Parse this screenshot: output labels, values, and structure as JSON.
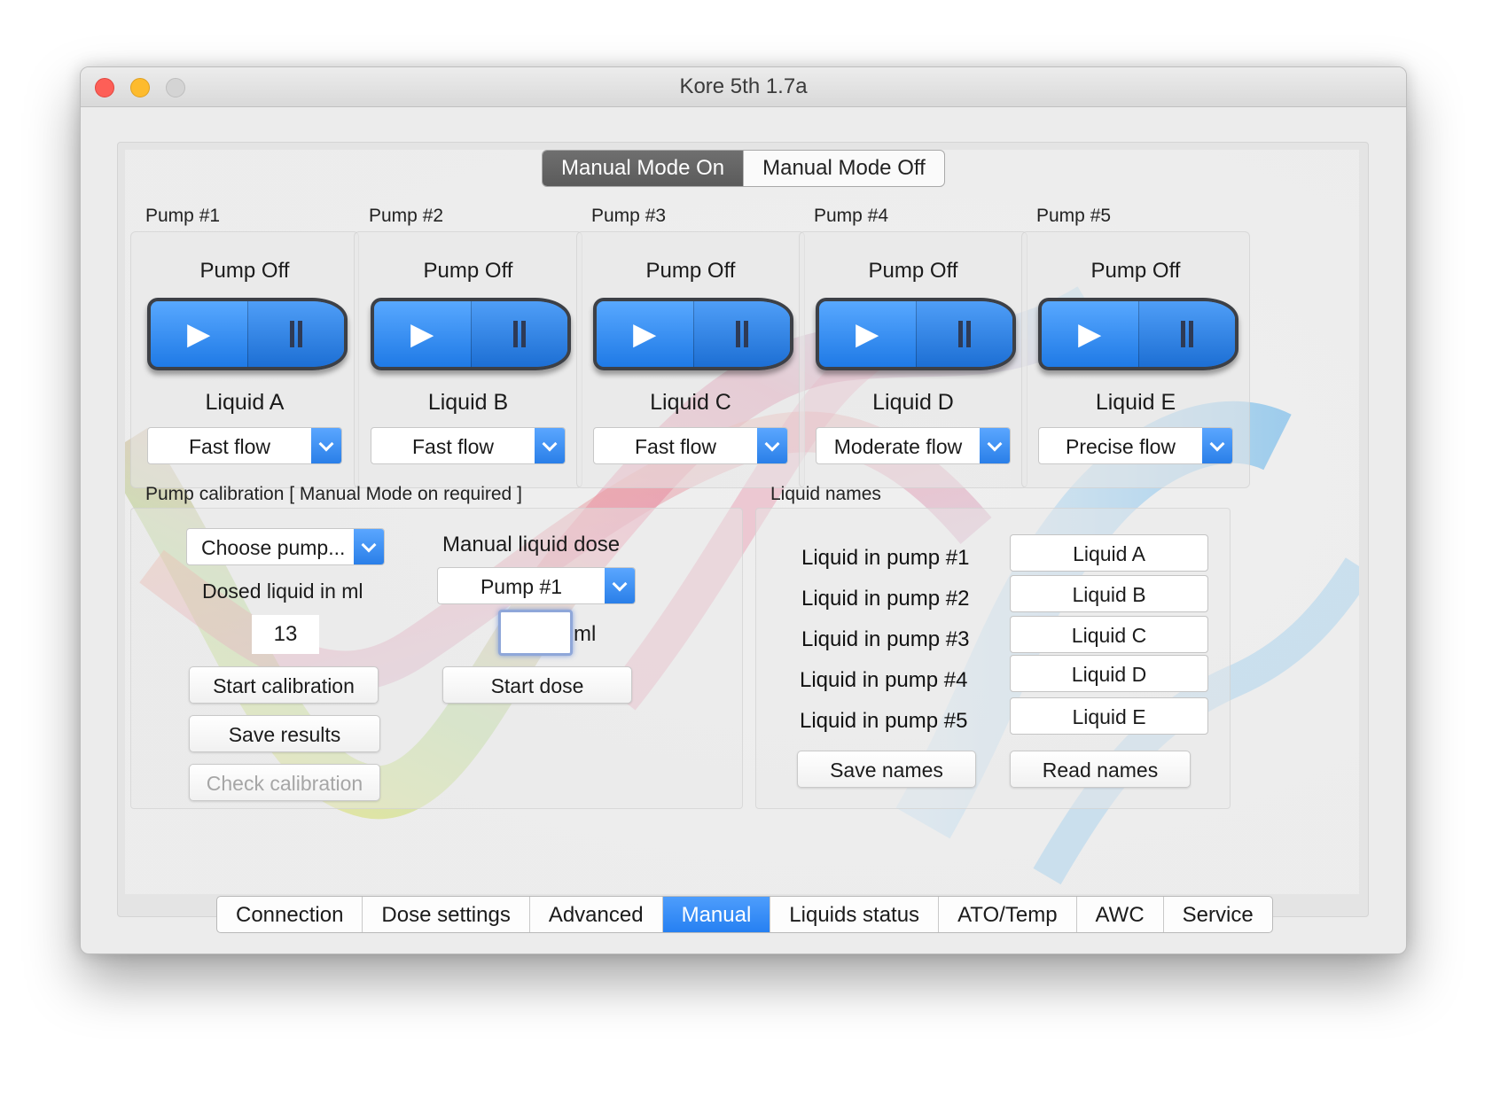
{
  "window": {
    "title": "Kore 5th 1.7a"
  },
  "mode_toggle": {
    "on_label": "Manual Mode On",
    "off_label": "Manual Mode Off",
    "active": "on"
  },
  "pumps": [
    {
      "label": "Pump #1",
      "status": "Pump Off",
      "liquid": "Liquid A",
      "flow": "Fast flow"
    },
    {
      "label": "Pump #2",
      "status": "Pump Off",
      "liquid": "Liquid B",
      "flow": "Fast flow"
    },
    {
      "label": "Pump #3",
      "status": "Pump Off",
      "liquid": "Liquid C",
      "flow": "Fast flow"
    },
    {
      "label": "Pump #4",
      "status": "Pump Off",
      "liquid": "Liquid D",
      "flow": "Moderate flow"
    },
    {
      "label": "Pump #5",
      "status": "Pump Off",
      "liquid": "Liquid E",
      "flow": "Precise flow"
    }
  ],
  "calibration": {
    "section_label": "Pump calibration [ Manual Mode on required ]",
    "choose_pump": "Choose pump...",
    "dosed_label": "Dosed liquid in ml",
    "dosed_value": "13",
    "start_button": "Start calibration",
    "save_button": "Save results",
    "check_button": "Check calibration"
  },
  "manual_dose": {
    "title": "Manual liquid dose",
    "pump_select": "Pump #1",
    "amount_value": "",
    "unit": "ml",
    "start_button": "Start dose"
  },
  "liquid_names": {
    "section_label": "Liquid names",
    "rows": [
      {
        "label": "Liquid in pump #1",
        "value": "Liquid A"
      },
      {
        "label": "Liquid in pump #2",
        "value": "Liquid B"
      },
      {
        "label": "Liquid in pump #3",
        "value": "Liquid C"
      },
      {
        "label": "Liquid in pump #4",
        "value": "Liquid D"
      },
      {
        "label": "Liquid in pump #5",
        "value": "Liquid E"
      }
    ],
    "save_button": "Save names",
    "read_button": "Read names"
  },
  "tabs": [
    "Connection",
    "Dose settings",
    "Advanced",
    "Manual",
    "Liquids status",
    "ATO/Temp",
    "AWC",
    "Service"
  ],
  "active_tab": "Manual",
  "colors": {
    "accent": "#2a80f0",
    "toggle_active": "#666666",
    "window_bg": "#ececec"
  },
  "icons": {
    "play": "play-icon",
    "pause": "pause-icon",
    "dropdown": "chevron-down-icon"
  }
}
